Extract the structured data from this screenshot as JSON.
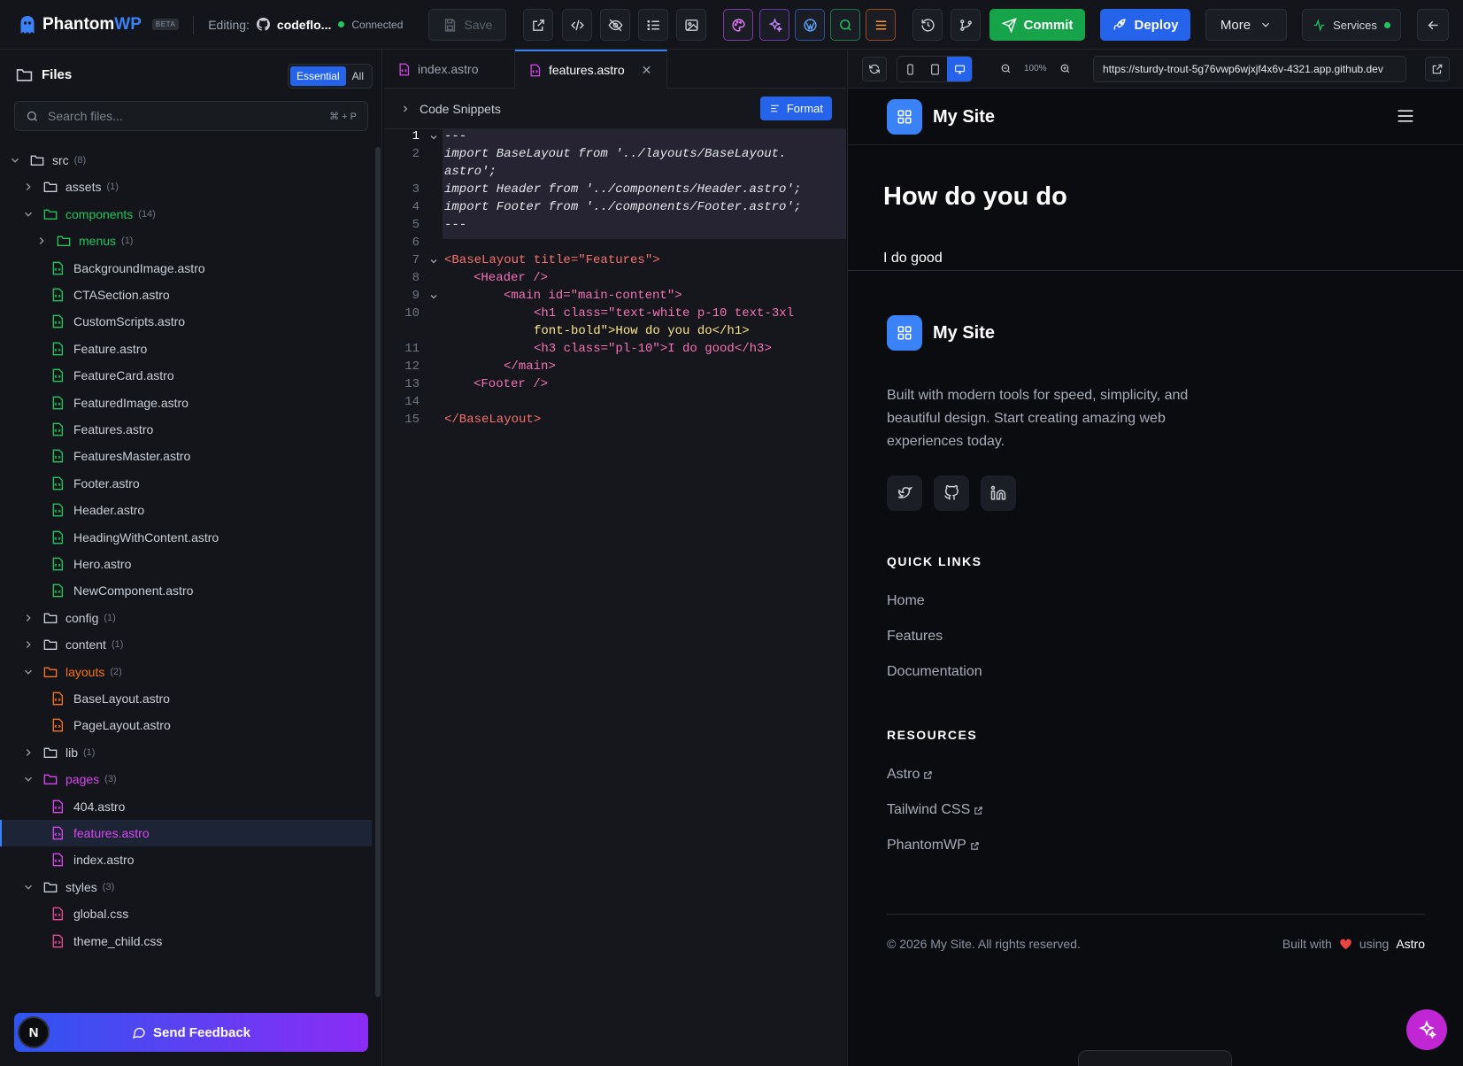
{
  "app": {
    "name_main": "Phantom",
    "name_accent": "WP",
    "beta": "BETA"
  },
  "editing": {
    "label": "Editing:",
    "repo": "codeflo...",
    "status": "Connected"
  },
  "toolbar": {
    "save": "Save",
    "commit": "Commit",
    "deploy": "Deploy",
    "more": "More",
    "services": "Services"
  },
  "sidebar": {
    "title": "Files",
    "seg_essential": "Essential",
    "seg_all": "All",
    "search_placeholder": "Search files...",
    "search_kbd": "⌘ + P",
    "tree": [
      {
        "label": "src",
        "count": "(8)",
        "kind": "folder",
        "depth": 0,
        "open": true,
        "color": "#c9ced6"
      },
      {
        "label": "assets",
        "count": "(1)",
        "kind": "folder",
        "depth": 1,
        "open": false,
        "color": "#c9ced6"
      },
      {
        "label": "components",
        "count": "(14)",
        "kind": "folder",
        "depth": 1,
        "open": true,
        "color": "#22c55e"
      },
      {
        "label": "menus",
        "count": "(1)",
        "kind": "folder",
        "depth": 2,
        "open": false,
        "color": "#22c55e"
      },
      {
        "label": "BackgroundImage.astro",
        "kind": "file",
        "depth": 2,
        "color": "#22c55e"
      },
      {
        "label": "CTASection.astro",
        "kind": "file",
        "depth": 2,
        "color": "#22c55e"
      },
      {
        "label": "CustomScripts.astro",
        "kind": "file",
        "depth": 2,
        "color": "#22c55e"
      },
      {
        "label": "Feature.astro",
        "kind": "file",
        "depth": 2,
        "color": "#22c55e"
      },
      {
        "label": "FeatureCard.astro",
        "kind": "file",
        "depth": 2,
        "color": "#22c55e"
      },
      {
        "label": "FeaturedImage.astro",
        "kind": "file",
        "depth": 2,
        "color": "#22c55e"
      },
      {
        "label": "Features.astro",
        "kind": "file",
        "depth": 2,
        "color": "#22c55e"
      },
      {
        "label": "FeaturesMaster.astro",
        "kind": "file",
        "depth": 2,
        "color": "#22c55e"
      },
      {
        "label": "Footer.astro",
        "kind": "file",
        "depth": 2,
        "color": "#22c55e"
      },
      {
        "label": "Header.astro",
        "kind": "file",
        "depth": 2,
        "color": "#22c55e"
      },
      {
        "label": "HeadingWithContent.astro",
        "kind": "file",
        "depth": 2,
        "color": "#22c55e"
      },
      {
        "label": "Hero.astro",
        "kind": "file",
        "depth": 2,
        "color": "#22c55e"
      },
      {
        "label": "NewComponent.astro",
        "kind": "file",
        "depth": 2,
        "color": "#22c55e"
      },
      {
        "label": "config",
        "count": "(1)",
        "kind": "folder",
        "depth": 1,
        "open": false,
        "color": "#c9ced6"
      },
      {
        "label": "content",
        "count": "(1)",
        "kind": "folder",
        "depth": 1,
        "open": false,
        "color": "#c9ced6"
      },
      {
        "label": "layouts",
        "count": "(2)",
        "kind": "folder",
        "depth": 1,
        "open": true,
        "color": "#f97316"
      },
      {
        "label": "BaseLayout.astro",
        "kind": "file",
        "depth": 2,
        "color": "#f97316"
      },
      {
        "label": "PageLayout.astro",
        "kind": "file",
        "depth": 2,
        "color": "#f97316"
      },
      {
        "label": "lib",
        "count": "(1)",
        "kind": "folder",
        "depth": 1,
        "open": false,
        "color": "#c9ced6"
      },
      {
        "label": "pages",
        "count": "(3)",
        "kind": "folder",
        "depth": 1,
        "open": true,
        "color": "#d946ef"
      },
      {
        "label": "404.astro",
        "kind": "file",
        "depth": 2,
        "color": "#d946ef"
      },
      {
        "label": "features.astro",
        "kind": "file",
        "depth": 2,
        "color": "#d946ef",
        "selected": true
      },
      {
        "label": "index.astro",
        "kind": "file",
        "depth": 2,
        "color": "#d946ef"
      },
      {
        "label": "styles",
        "count": "(3)",
        "kind": "folder",
        "depth": 1,
        "open": true,
        "color": "#c9ced6"
      },
      {
        "label": "global.css",
        "kind": "file",
        "depth": 2,
        "color": "#ec4899"
      },
      {
        "label": "theme_child.css",
        "kind": "file",
        "depth": 2,
        "color": "#ec4899"
      }
    ],
    "feedback": "Send Feedback",
    "avatar": "N"
  },
  "editor": {
    "tabs": [
      "index.astro",
      "features.astro"
    ],
    "snippets": "Code Snippets",
    "format": "Format",
    "line_numbers": [
      "1",
      "2",
      "3",
      "4",
      "5",
      "6",
      "7",
      "8",
      "9",
      "10",
      "11",
      "12",
      "13",
      "14",
      "15"
    ],
    "lines": [
      "---",
      "import BaseLayout from '../layouts/BaseLayout.",
      "astro';",
      "import Header from '../components/Header.astro';",
      "import Footer from '../components/Footer.astro';",
      "---",
      "",
      "<BaseLayout title=\"Features\">",
      "<Header />",
      "<main id=\"main-content\">",
      "<h1 class=\"text-white p-10 text-3xl",
      "font-bold\">How do you do</h1>",
      "<h3 class=\"pl-10\">I do good</h3>",
      "</main>",
      "<Footer />",
      "",
      "</BaseLayout>"
    ]
  },
  "preview": {
    "zoom": "100%",
    "url": "https://sturdy-trout-5g76vwp6wjxjf4x6v-4321.app.github.dev",
    "site_name": "My Site",
    "heading": "How do you do",
    "subheading": "I do good",
    "tagline": "Built with modern tools for speed, simplicity, and beautiful design. Start creating amazing web experiences today.",
    "quick_links_title": "QUICK LINKS",
    "quick_links": [
      "Home",
      "Features",
      "Documentation"
    ],
    "resources_title": "RESOURCES",
    "resources": [
      "Astro",
      "Tailwind CSS",
      "PhantomWP"
    ],
    "copyright": "© 2026 My Site. All rights reserved.",
    "built_with": "Built with",
    "using": "using",
    "built_tool": "Astro"
  },
  "colors": {
    "accent": "#2563eb",
    "commit": "#16a34a",
    "connected": "#22c55e",
    "feedback_from": "#2f54f0",
    "feedback_to": "#8b2cf5"
  }
}
